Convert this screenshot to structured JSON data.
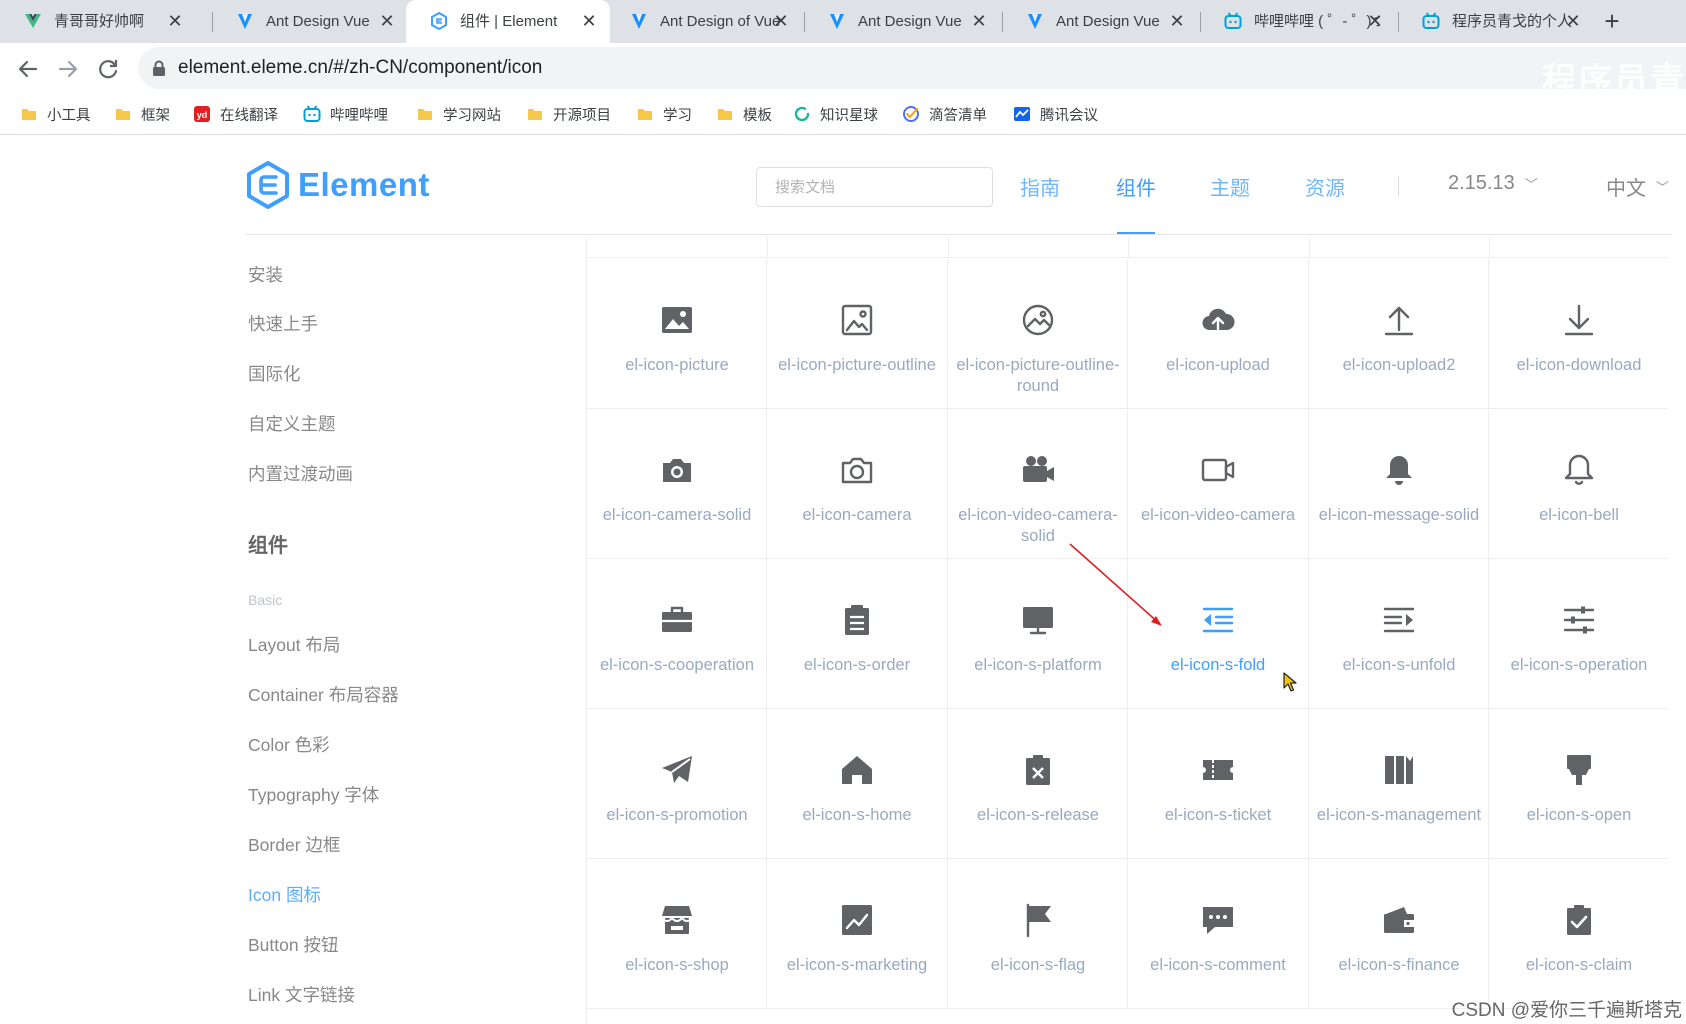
{
  "browser": {
    "tabs": [
      {
        "title": "青哥哥好帅啊",
        "icon": "vue-icon",
        "active": false
      },
      {
        "title": "Ant Design Vue",
        "icon": "ant-design-icon",
        "active": false
      },
      {
        "title": "组件 | Element",
        "icon": "element-icon",
        "active": true
      },
      {
        "title": "Ant Design of Vue",
        "icon": "ant-design-icon",
        "active": false
      },
      {
        "title": "Ant Design Vue",
        "icon": "ant-design-icon",
        "active": false
      },
      {
        "title": "Ant Design Vue",
        "icon": "ant-design-icon",
        "active": false
      },
      {
        "title": "哔哩哔哩 ( ゜- ゜)つ",
        "icon": "bilibili-icon",
        "active": false
      },
      {
        "title": "程序员青戈的个人",
        "icon": "bilibili-icon",
        "active": false
      }
    ],
    "url": "element.eleme.cn/#/zh-CN/component/icon",
    "watermark": "程序员青",
    "bookmarks": [
      {
        "label": "小工具",
        "icon": "folder-icon"
      },
      {
        "label": "框架",
        "icon": "folder-icon"
      },
      {
        "label": "在线翻译",
        "icon": "youdao-icon"
      },
      {
        "label": "哔哩哔哩",
        "icon": "bilibili-icon"
      },
      {
        "label": "学习网站",
        "icon": "folder-icon"
      },
      {
        "label": "开源项目",
        "icon": "folder-icon"
      },
      {
        "label": "学习",
        "icon": "folder-icon"
      },
      {
        "label": "模板",
        "icon": "folder-icon"
      },
      {
        "label": "知识星球",
        "icon": "zsxq-icon"
      },
      {
        "label": "滴答清单",
        "icon": "ticktick-icon"
      },
      {
        "label": "腾讯会议",
        "icon": "tencent-meeting-icon"
      }
    ]
  },
  "header": {
    "logo_text": "Element",
    "search_placeholder": "搜索文档",
    "nav": [
      {
        "label": "指南",
        "active": false
      },
      {
        "label": "组件",
        "active": true
      },
      {
        "label": "主题",
        "active": false
      },
      {
        "label": "资源",
        "active": false
      }
    ],
    "version": "2.15.13",
    "language": "中文"
  },
  "sidebar": {
    "top_items": [
      "安装",
      "快速上手",
      "国际化",
      "自定义主题",
      "内置过渡动画"
    ],
    "group_title": "组件",
    "subgroup": "Basic",
    "items": [
      {
        "label": "Layout 布局",
        "active": false
      },
      {
        "label": "Container 布局容器",
        "active": false
      },
      {
        "label": "Color 色彩",
        "active": false
      },
      {
        "label": "Typography 字体",
        "active": false
      },
      {
        "label": "Border 边框",
        "active": false
      },
      {
        "label": "Icon 图标",
        "active": true
      },
      {
        "label": "Button 按钮",
        "active": false
      },
      {
        "label": "Link 文字链接",
        "active": false
      }
    ]
  },
  "icons": [
    [
      "el-icon-picture",
      "el-icon-picture-outline",
      "el-icon-picture-outline-round",
      "el-icon-upload",
      "el-icon-upload2",
      "el-icon-download"
    ],
    [
      "el-icon-camera-solid",
      "el-icon-camera",
      "el-icon-video-camera-solid",
      "el-icon-video-camera",
      "el-icon-message-solid",
      "el-icon-bell"
    ],
    [
      "el-icon-s-cooperation",
      "el-icon-s-order",
      "el-icon-s-platform",
      "el-icon-s-fold",
      "el-icon-s-unfold",
      "el-icon-s-operation"
    ],
    [
      "el-icon-s-promotion",
      "el-icon-s-home",
      "el-icon-s-release",
      "el-icon-s-ticket",
      "el-icon-s-management",
      "el-icon-s-open"
    ],
    [
      "el-icon-s-shop",
      "el-icon-s-marketing",
      "el-icon-s-flag",
      "el-icon-s-comment",
      "el-icon-s-finance",
      "el-icon-s-claim"
    ]
  ],
  "hovered_icon": "el-icon-s-fold",
  "colors": {
    "brand": "#409eff",
    "icon": "#606266",
    "icon_label": "#99a9bf",
    "annotation_arrow": "#e02020"
  },
  "credit": "CSDN @爱你三千遍斯塔克"
}
